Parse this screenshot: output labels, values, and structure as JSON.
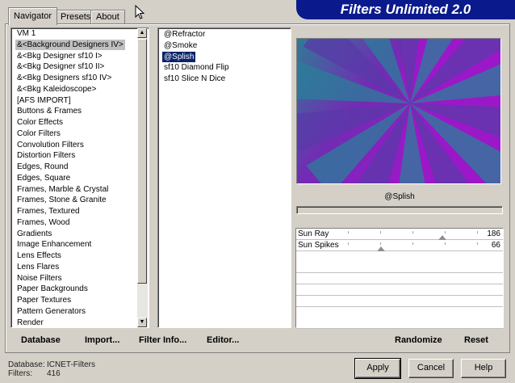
{
  "tabs": [
    "Navigator",
    "Presets",
    "About"
  ],
  "banner_title": "Filters Unlimited 2.0",
  "categories": {
    "items": [
      "VM 1",
      "&<Background Designers IV>",
      "&<Bkg Designer sf10 I>",
      "&<Bkg Designer sf10 II>",
      "&<Bkg Designers sf10 IV>",
      "&<Bkg Kaleidoscope>",
      "[AFS IMPORT]",
      "Buttons & Frames",
      "Color Effects",
      "Color Filters",
      "Convolution Filters",
      "Distortion Filters",
      "Edges, Round",
      "Edges, Square",
      "Frames, Marble & Crystal",
      "Frames, Stone & Granite",
      "Frames, Textured",
      "Frames, Wood",
      "Gradients",
      "Image Enhancement",
      "Lens Effects",
      "Lens Flares",
      "Noise Filters",
      "Paper Backgrounds",
      "Paper Textures",
      "Pattern Generators",
      "Render"
    ],
    "selected_index": 1
  },
  "filters": {
    "items": [
      "@Refractor",
      "@Smoke",
      "@Splish",
      "sf10 Diamond Flip",
      "sf10 Slice N Dice"
    ],
    "selected_index": 2
  },
  "preview": {
    "caption": "@Splish"
  },
  "params": [
    {
      "name": "Sun Ray",
      "value": "186",
      "level": 186
    },
    {
      "name": "Sun Spikes",
      "value": "66",
      "level": 66
    }
  ],
  "actions": {
    "database": "Database",
    "import": "Import...",
    "filter_info": "Filter Info...",
    "editor": "Editor...",
    "randomize": "Randomize",
    "reset": "Reset"
  },
  "status": {
    "database_label": "Database:",
    "database_value": "ICNET-Filters",
    "filters_label": "Filters:",
    "filters_value": "416"
  },
  "buttons": {
    "apply": "Apply",
    "cancel": "Cancel",
    "help": "Help"
  },
  "colors": {
    "banner": "#0a1a8c",
    "selection": "#0a246a",
    "preview_purple": "#9b18c8",
    "preview_teal": "#1e8c8c"
  }
}
